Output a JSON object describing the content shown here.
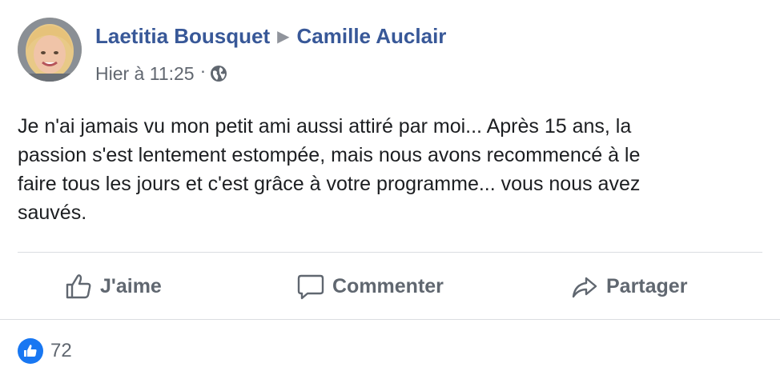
{
  "post": {
    "author": "Laetitia Bousquet",
    "recipient": "Camille Auclair",
    "timestamp": "Hier à 11:25",
    "separator": "·",
    "audience_icon": "globe-icon",
    "message": "Je n'ai jamais vu mon petit ami aussi attiré par moi... Après 15 ans, la\npassion s'est lentement estompée, mais nous avons recommencé à le\nfaire tous les jours et c'est grâce à votre programme... vous nous avez\nsauvés."
  },
  "actions": {
    "like_label": "J'aime",
    "comment_label": "Commenter",
    "share_label": "Partager"
  },
  "reactions": {
    "count": "72",
    "icon": "thumbs-up-icon"
  },
  "colors": {
    "name_link": "#385898",
    "secondary_text": "#616770",
    "like_blue": "#1877f2"
  }
}
